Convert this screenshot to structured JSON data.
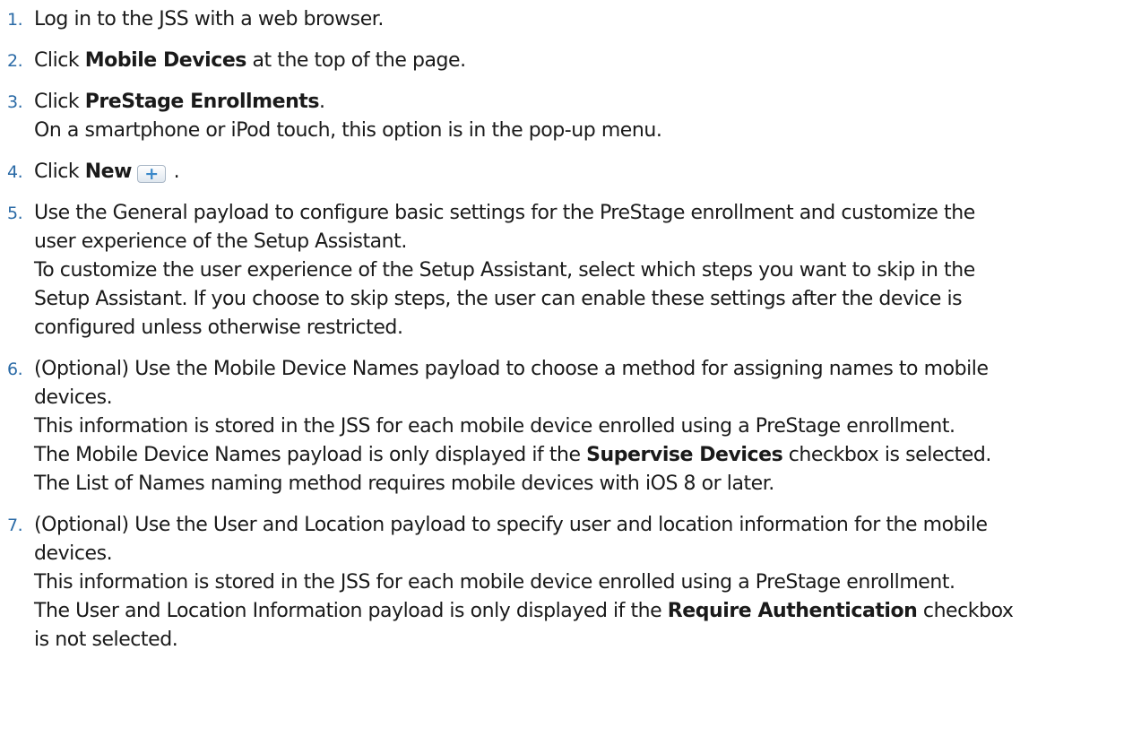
{
  "steps": [
    {
      "num": "1.",
      "text": "Log in to the JSS with a web browser."
    },
    {
      "num": "2.",
      "pre": "Click ",
      "bold": "Mobile Devices",
      "post": " at the top of the page."
    },
    {
      "num": "3.",
      "pre": "Click ",
      "bold": "PreStage Enrollments",
      "post": ".",
      "note": "On a smartphone or iPod touch, this option is in the pop-up menu."
    },
    {
      "num": "4.",
      "pre": "Click ",
      "bold": "New",
      "button_glyph": "+",
      "button_icon": "plus-icon",
      "post": " ."
    },
    {
      "num": "5.",
      "lines": [
        "Use the General payload to configure basic settings for the PreStage enrollment and customize the",
        "user experience of the Setup Assistant."
      ],
      "note_lines": [
        "To customize the user experience of the Setup Assistant, select which steps you want to skip in the",
        "Setup Assistant. If you choose to skip steps, the user can enable these settings after the device is",
        "configured unless otherwise restricted."
      ]
    },
    {
      "num": "6.",
      "lines": [
        "(Optional) Use the Mobile Device Names payload to choose a method for assigning names to mobile",
        "devices."
      ],
      "note1": "This information is stored in the JSS for each mobile device enrolled using a PreStage enrollment.",
      "note2_pre": "The Mobile Device Names payload is only displayed if the ",
      "note2_bold": "Supervise Devices",
      "note2_post": " checkbox is selected.",
      "note3": "The List of Names naming method requires mobile devices with iOS 8 or later."
    },
    {
      "num": "7.",
      "lines": [
        "(Optional) Use the User and Location payload to specify user and location information for the mobile",
        "devices."
      ],
      "note1": "This information is stored in the JSS for each mobile device enrolled using a PreStage enrollment.",
      "note2_pre": "The User and Location Information payload is only displayed if the ",
      "note2_bold": "Require Authentication",
      "note2_post": " checkbox",
      "note3": "is not selected."
    }
  ],
  "colors": {
    "number": "#2a6aa6",
    "text": "#1a1a1a",
    "button_plus": "#3a88c9"
  }
}
